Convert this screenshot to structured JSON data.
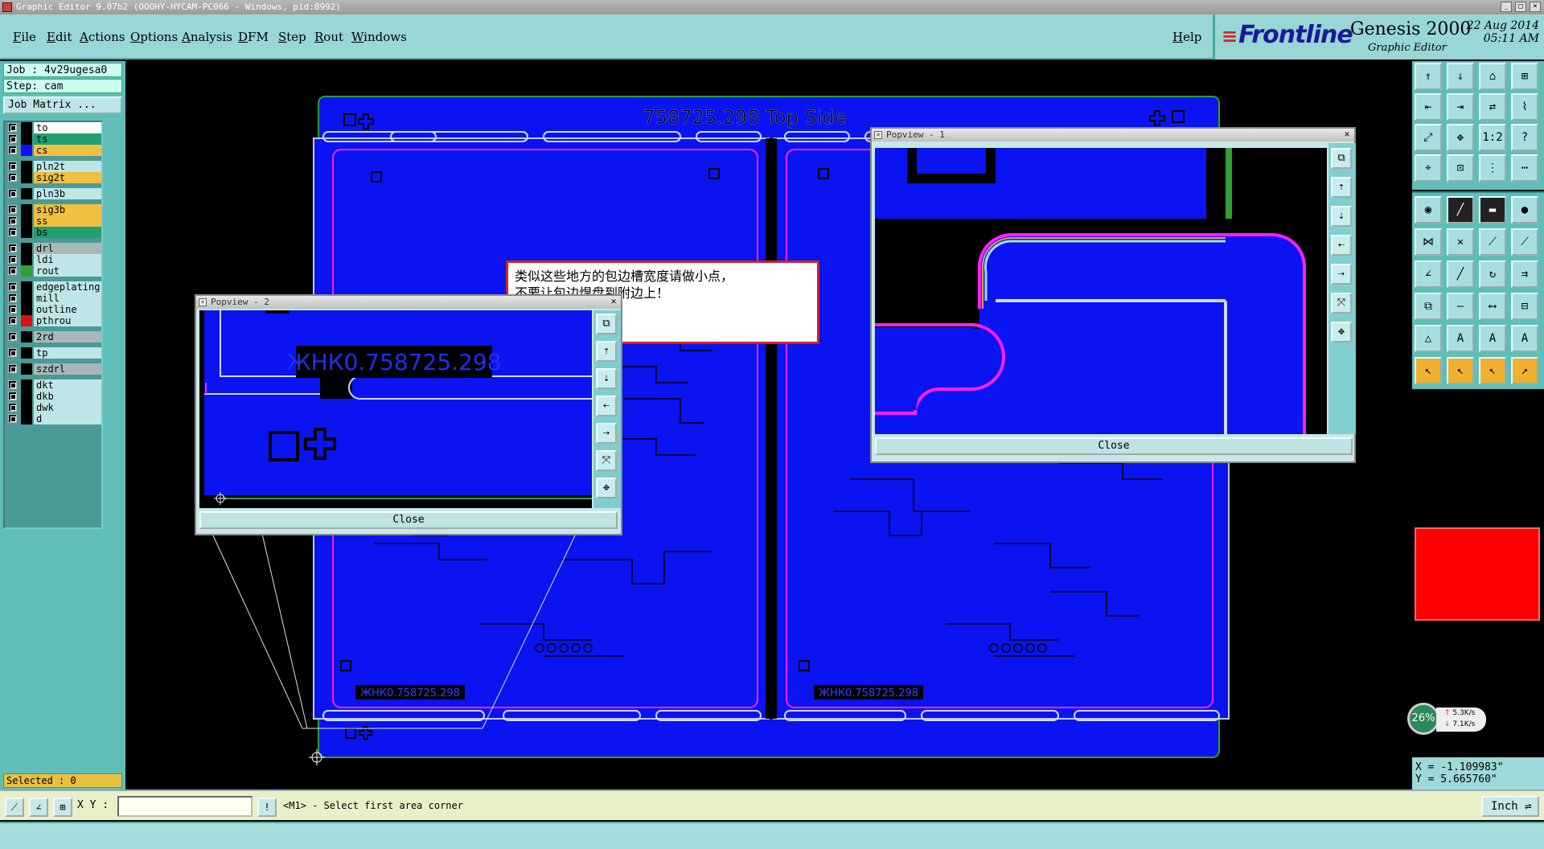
{
  "window": {
    "title": "Graphic Editor 9.07b2 (OOOHY-HYCAM-PC066 - Windows, pid:8992)"
  },
  "menu": {
    "items": [
      "File",
      "Edit",
      "Actions",
      "Options",
      "Analysis",
      "DFM",
      "Step",
      "Rout",
      "Windows"
    ],
    "help": "Help"
  },
  "brand": {
    "logo": "Frontline",
    "product": "Genesis 2000",
    "subtitle": "Graphic Editor",
    "date": "22 Aug 2014",
    "time": "05:11 AM"
  },
  "left_panel": {
    "job": "Job : 4v29ugesa0",
    "step": "Step: cam",
    "job_matrix_button": "Job Matrix ...",
    "selected": "Selected : 0",
    "layers": [
      {
        "name": "to",
        "bg": "#ffffff",
        "swatch": "#000000"
      },
      {
        "name": "ts",
        "bg": "#20a070",
        "swatch": "#000000"
      },
      {
        "name": "cs",
        "bg": "#f0c040",
        "swatch": "#1010ff"
      },
      {
        "name": "pln2t",
        "bg": "#bfe6e6",
        "swatch": "#000000"
      },
      {
        "name": "sig2t",
        "bg": "#f0c040",
        "swatch": "#000000"
      },
      {
        "name": "pln3b",
        "bg": "#bfe6e6",
        "swatch": "#000000"
      },
      {
        "name": "sig3b",
        "bg": "#f0c040",
        "swatch": "#000000"
      },
      {
        "name": "ss",
        "bg": "#f0c040",
        "swatch": "#000000"
      },
      {
        "name": "bs",
        "bg": "#20a070",
        "swatch": "#000000"
      },
      {
        "name": "drl",
        "bg": "#a8b8b8",
        "swatch": "#000000"
      },
      {
        "name": "ldi",
        "bg": "#bfe6e6",
        "swatch": "#000000"
      },
      {
        "name": "rout",
        "bg": "#bfe6e6",
        "swatch": "#30a030"
      },
      {
        "name": "edgeplating",
        "bg": "#bfe6e6",
        "swatch": "#000000"
      },
      {
        "name": "mill",
        "bg": "#bfe6e6",
        "swatch": "#000000"
      },
      {
        "name": "outline",
        "bg": "#bfe6e6",
        "swatch": "#000000"
      },
      {
        "name": "pthrou",
        "bg": "#bfe6e6",
        "swatch": "#e01010"
      },
      {
        "name": "2rd",
        "bg": "#a8b8b8",
        "swatch": "#000000"
      },
      {
        "name": "tp",
        "bg": "#bfe6e6",
        "swatch": "#000000"
      },
      {
        "name": "szdrl",
        "bg": "#a8b8b8",
        "swatch": "#000000"
      },
      {
        "name": "dkt",
        "bg": "#bfe6e6",
        "swatch": "#000000"
      },
      {
        "name": "dkb",
        "bg": "#bfe6e6",
        "swatch": "#000000"
      },
      {
        "name": "dwk",
        "bg": "#bfe6e6",
        "swatch": "#000000"
      },
      {
        "name": "d",
        "bg": "#bfe6e6",
        "swatch": "#000000"
      }
    ]
  },
  "canvas": {
    "board_title": "758725.298 Top Side",
    "board_label_left": "ЖНК0.758725.298",
    "board_label_right": "ЖНК0.758725.298",
    "note_line1": "类似这些地方的包边槽宽度请做小点，",
    "note_line2": "不要让包边焊盘到附边上！"
  },
  "popview2": {
    "title": "Popview - 2",
    "label": "ЖНК0.758725.298",
    "close_label": "Close"
  },
  "popview1": {
    "title": "Popview - 1",
    "close_label": "Close"
  },
  "right_panel": {
    "net_percent": "26%",
    "upload_rate": "5.3K/s",
    "download_rate": "7.1K/s",
    "x_coord": "X = -1.109983\"",
    "y_coord": "Y = 5.665760\""
  },
  "command_bar": {
    "xy_label": "X Y :",
    "xy_value": "",
    "prompt": "<M1> - Select first area corner",
    "units": "Inch"
  },
  "colors": {
    "board_blue": "#0a14f0",
    "copper_outline": "#000000",
    "magenta_trace": "#ff20ff",
    "panel_teal": "#99d6d6",
    "note_border": "#d02020"
  },
  "icons": [
    "app-icon",
    "minimize-icon",
    "maximize-icon",
    "close-icon",
    "frontline-logo",
    "crosshair-icon",
    "network-speed-widget"
  ]
}
